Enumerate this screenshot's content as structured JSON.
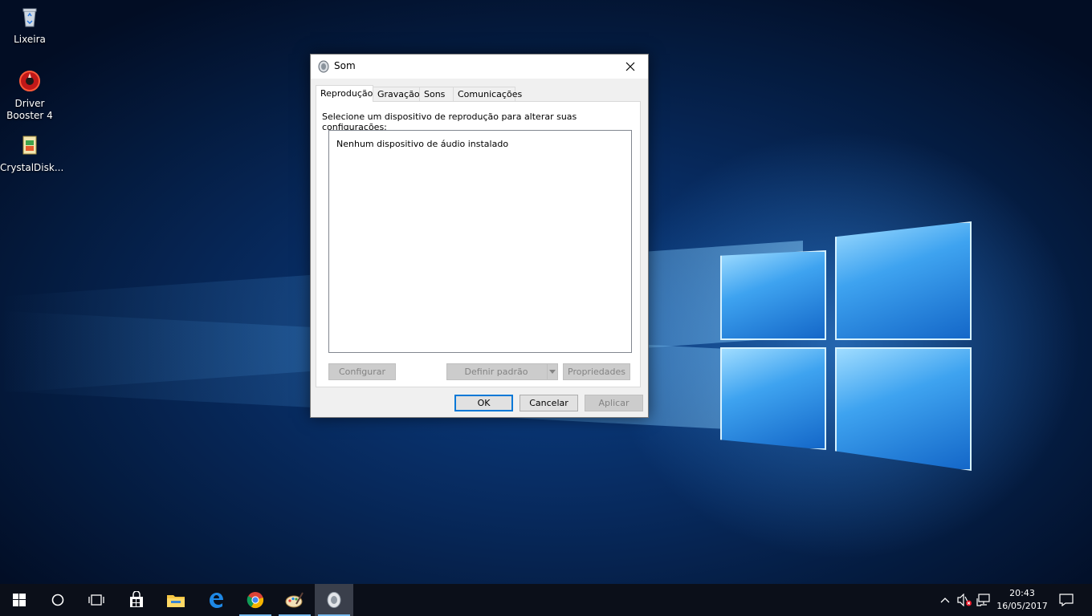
{
  "desktop": {
    "icons": [
      {
        "label": "Lixeira",
        "icon": "recycle-bin-icon"
      },
      {
        "label": "Driver Booster 4",
        "icon": "driver-booster-icon"
      },
      {
        "label": "CrystalDisk...",
        "icon": "crystaldisk-icon"
      }
    ]
  },
  "dialog": {
    "title": "Som",
    "tabs": [
      {
        "label": "Reprodução",
        "active": true
      },
      {
        "label": "Gravação"
      },
      {
        "label": "Sons"
      },
      {
        "label": "Comunicações"
      }
    ],
    "instruction": "Selecione um dispositivo de reprodução para alterar suas configurações:",
    "device_list_empty": "Nenhum dispositivo de áudio instalado",
    "buttons": {
      "configure": "Configurar",
      "set_default": "Definir padrão",
      "properties": "Propriedades",
      "ok": "OK",
      "cancel": "Cancelar",
      "apply": "Aplicar"
    }
  },
  "taskbar": {
    "apps": [
      "start-icon",
      "cortana-icon",
      "task-view-icon",
      "store-icon",
      "file-explorer-icon",
      "edge-icon",
      "chrome-icon",
      "paint-icon",
      "sound-icon"
    ],
    "clock_time": "20:43",
    "clock_date": "16/05/2017"
  },
  "colors": {
    "accent": "#0078d7",
    "taskbar": "#0b0f19",
    "running_indicator": "#76b9ed"
  }
}
